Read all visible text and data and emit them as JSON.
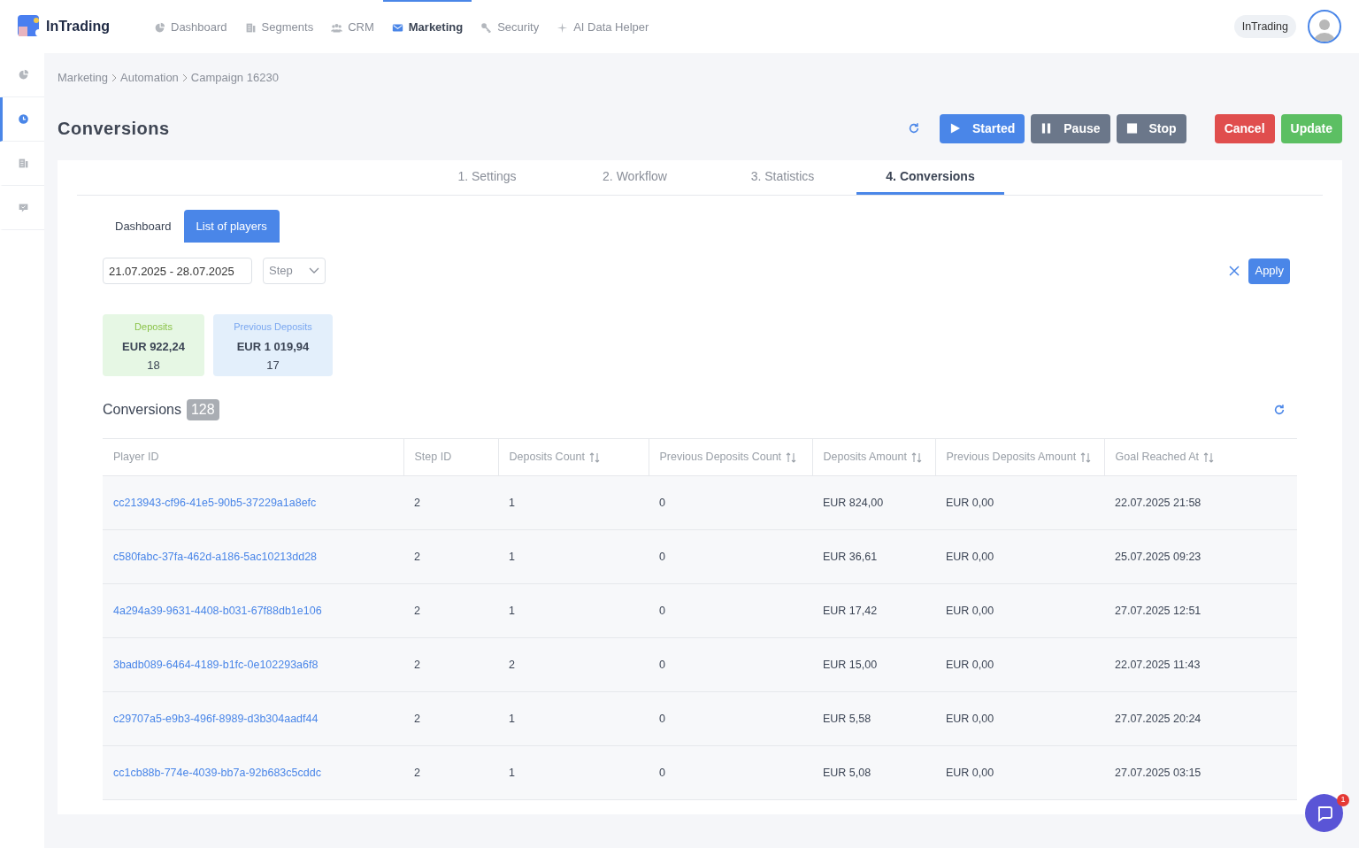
{
  "brand": {
    "name": "InTrading"
  },
  "nav": [
    {
      "label": "Dashboard",
      "selected": false
    },
    {
      "label": "Segments",
      "selected": false
    },
    {
      "label": "CRM",
      "selected": false
    },
    {
      "label": "Marketing",
      "selected": true
    },
    {
      "label": "Security",
      "selected": false
    },
    {
      "label": "AI Data Helper",
      "selected": false
    }
  ],
  "account": {
    "name": "InTrading"
  },
  "sidebar": {
    "items": [
      {
        "selected": false
      },
      {
        "selected": true
      },
      {
        "selected": false
      },
      {
        "selected": false
      }
    ]
  },
  "breadcrumb": [
    "Marketing",
    "Automation",
    "Campaign 16230"
  ],
  "page_title": "Conversions",
  "actions": [
    {
      "label": "Started",
      "kind": "play"
    },
    {
      "label": "Pause",
      "kind": "pause"
    },
    {
      "label": "Stop",
      "kind": "stop"
    },
    {
      "label": "Cancel",
      "kind": "cancel"
    },
    {
      "label": "Update",
      "kind": "update"
    }
  ],
  "tabs": [
    {
      "label": "1. Settings",
      "selected": false
    },
    {
      "label": "2. Workflow",
      "selected": false
    },
    {
      "label": "3. Statistics",
      "selected": false
    },
    {
      "label": "4. Conversions",
      "selected": true
    }
  ],
  "subtabs": [
    {
      "label": "Dashboard",
      "selected": false
    },
    {
      "label": "List of players",
      "selected": true
    }
  ],
  "filters": {
    "date_range": "21.07.2025 - 28.07.2025",
    "step_placeholder": "Step",
    "apply": "Apply"
  },
  "stats": [
    {
      "label": "Deposits",
      "amount": "EUR 922,24",
      "count": "18",
      "color": "#e6f7e4"
    },
    {
      "label": "Previous Deposits",
      "amount": "EUR 1 019,94",
      "count": "17",
      "color": "#e3effb"
    }
  ],
  "conversions": {
    "title": "Conversions",
    "count": "128"
  },
  "table": {
    "columns": [
      {
        "label": "Player ID",
        "sortable": false
      },
      {
        "label": "Step ID",
        "sortable": false
      },
      {
        "label": "Deposits Count",
        "sortable": true
      },
      {
        "label": "Previous Deposits Count",
        "sortable": true
      },
      {
        "label": "Deposits Amount",
        "sortable": true
      },
      {
        "label": "Previous Deposits Amount",
        "sortable": true
      },
      {
        "label": "Goal Reached At",
        "sortable": true
      }
    ],
    "rows": [
      [
        "cc213943-cf96-41e5-90b5-37229a1a8efc",
        "2",
        "1",
        "0",
        "EUR 824,00",
        "EUR 0,00",
        "22.07.2025 21:58"
      ],
      [
        "c580fabc-37fa-462d-a186-5ac10213dd28",
        "2",
        "1",
        "0",
        "EUR 36,61",
        "EUR 0,00",
        "25.07.2025 09:23"
      ],
      [
        "4a294a39-9631-4408-b031-67f88db1e106",
        "2",
        "1",
        "0",
        "EUR 17,42",
        "EUR 0,00",
        "27.07.2025 12:51"
      ],
      [
        "3badb089-6464-4189-b1fc-0e102293a6f8",
        "2",
        "2",
        "0",
        "EUR 15,00",
        "EUR 0,00",
        "22.07.2025 11:43"
      ],
      [
        "c29707a5-e9b3-496f-8989-d3b304aadf44",
        "2",
        "1",
        "0",
        "EUR 5,58",
        "EUR 0,00",
        "27.07.2025 20:24"
      ],
      [
        "cc1cb88b-774e-4039-bb7a-92b683c5cddc",
        "2",
        "1",
        "0",
        "EUR 5,08",
        "EUR 0,00",
        "27.07.2025 03:15"
      ]
    ]
  },
  "chat": {
    "badge": "1"
  }
}
